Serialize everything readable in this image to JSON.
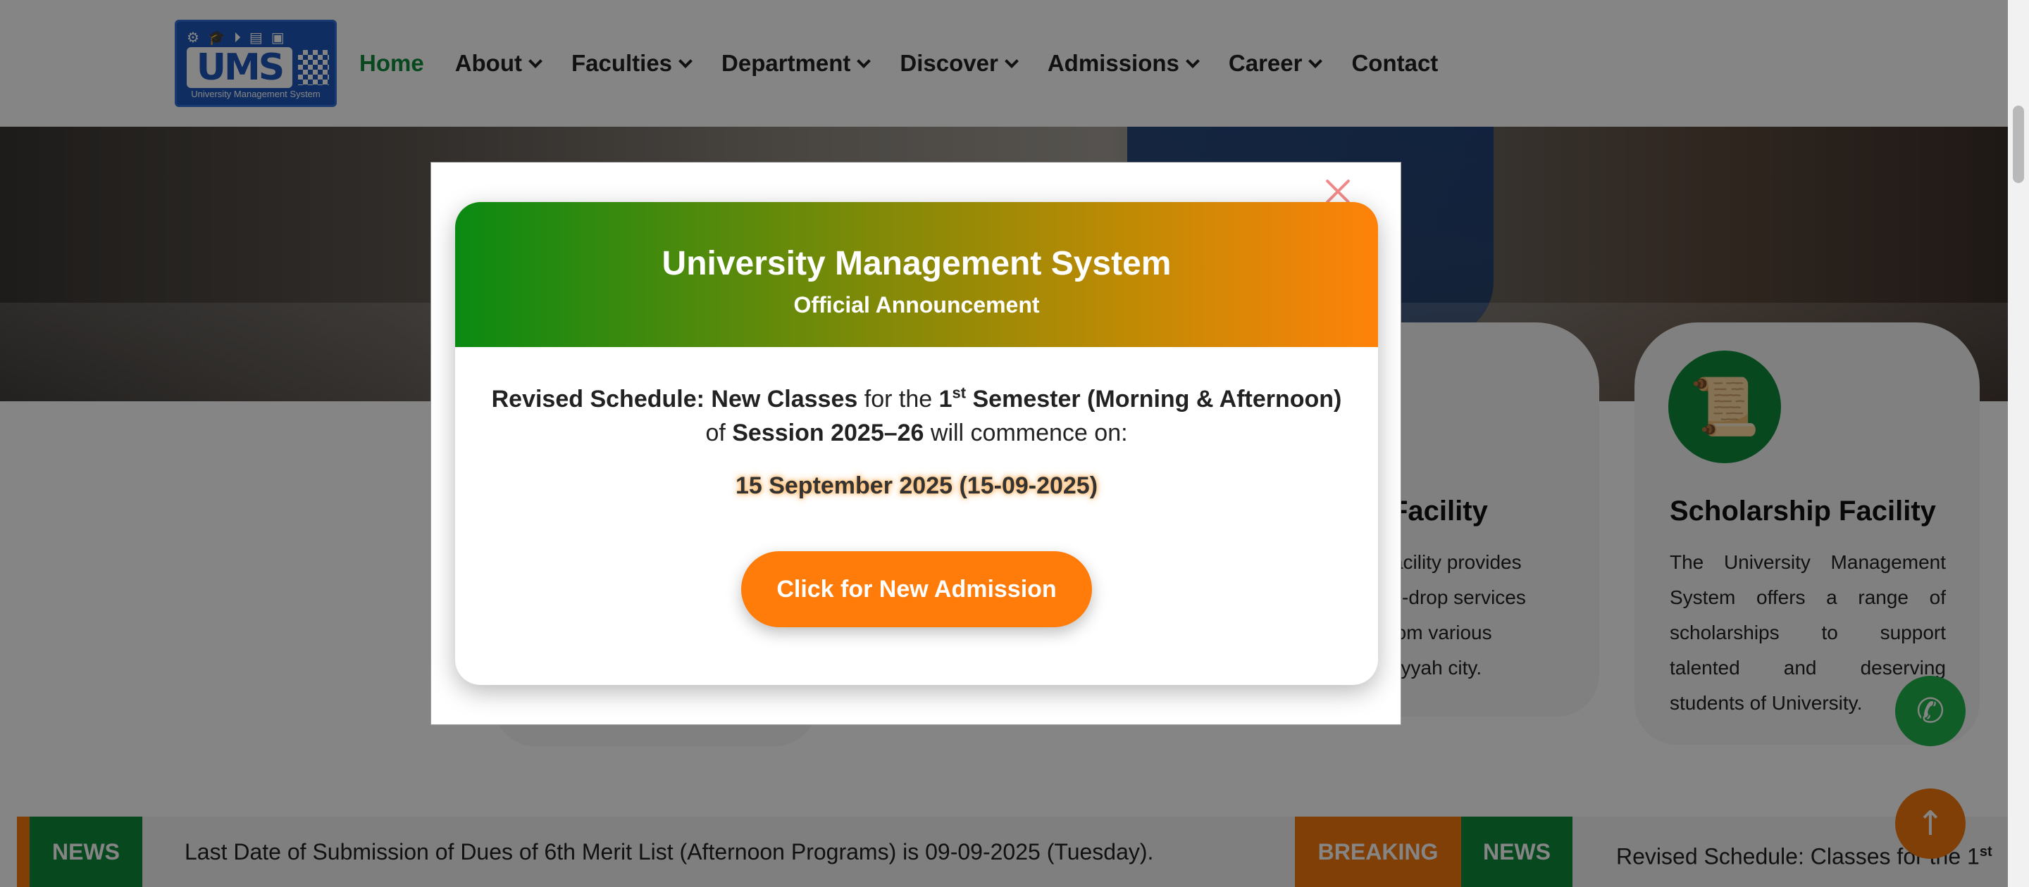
{
  "nav": {
    "logo_caption": "University Management System",
    "logo_mark": "UMS",
    "items": [
      {
        "label": "Home",
        "active": true,
        "dropdown": false
      },
      {
        "label": "About",
        "dropdown": true
      },
      {
        "label": "Faculties",
        "dropdown": true
      },
      {
        "label": "Department",
        "dropdown": true
      },
      {
        "label": "Discover",
        "dropdown": true
      },
      {
        "label": "Admissions",
        "dropdown": true
      },
      {
        "label": "Career",
        "dropdown": true
      },
      {
        "label": "Contact",
        "dropdown": false
      }
    ]
  },
  "cards": {
    "transport": {
      "title_partial": "rt Facility",
      "lines": [
        "rt Facility provides",
        "-and-drop services",
        "ts from various",
        "d Layyah city."
      ]
    },
    "scholarship": {
      "title": "Scholarship Facility",
      "text": "The University Management System offers a range of scholarships to support talented and deserving students of University."
    }
  },
  "ticker": {
    "news_label": "NEWS",
    "item1": "Last Date of Submission of Dues of 6th Merit List (Afternoon Programs) is 09-09-2025 (Tuesday).",
    "breaking_label": "BREAKING",
    "news_label2": "NEWS",
    "item2_prefix": "Revised Schedule: Classes for the 1",
    "item2_sup": "st"
  },
  "modal": {
    "title": "University Management System",
    "subtitle": "Official Announcement",
    "msg_bold1": "Revised Schedule: New Classes",
    "msg_plain1": " for the ",
    "msg_bold2": "1",
    "msg_sup": "st",
    "msg_bold3": " Semester (Morning & Afternoon)",
    "msg_plain2": "of ",
    "msg_bold4": "Session 2025–26",
    "msg_plain3": " will commence on:",
    "date": "15 September 2025 (15-09-2025)",
    "cta_label": "Click for New Admission"
  },
  "colors": {
    "brand_green": "#0e8a3a",
    "accent_orange": "#f47a0c",
    "logo_blue": "#1e56b8"
  }
}
